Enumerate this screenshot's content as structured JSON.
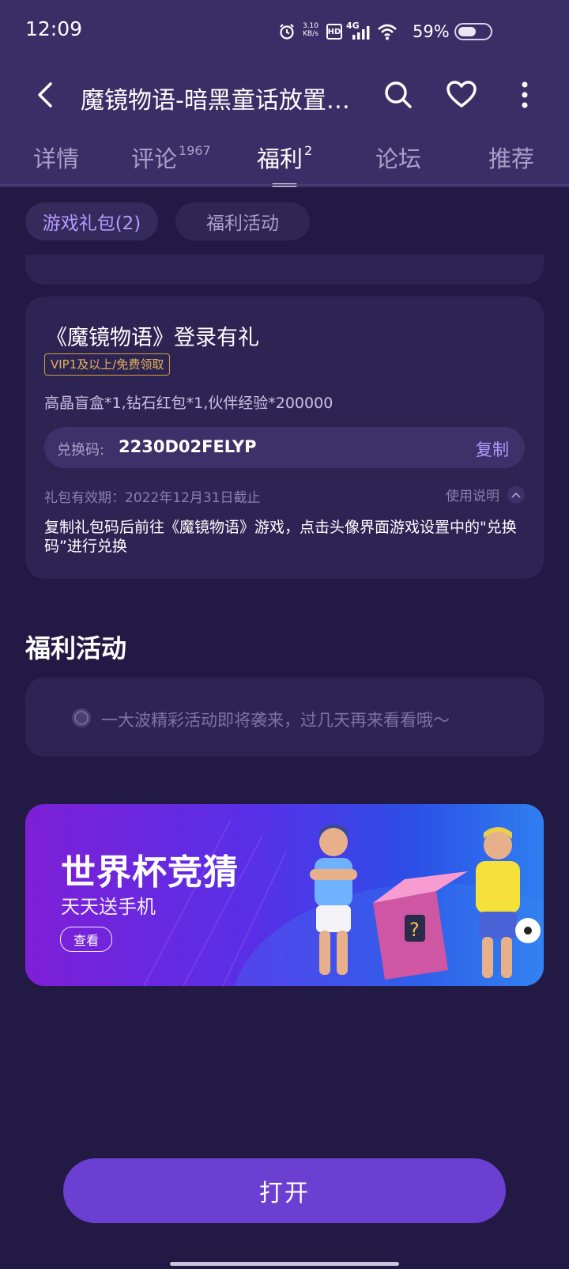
{
  "status_bar": {
    "time": "12:09",
    "speed_value": "3.10",
    "speed_unit": "KB/s",
    "hd": "HD",
    "network": "4G",
    "battery_percent": "59%",
    "battery_level": 0.59
  },
  "nav": {
    "title": "魔镜物语-暗黑童话放置RPG",
    "back_icon": "chevron-left-icon",
    "search_icon": "search-icon",
    "favorite_icon": "heart-icon",
    "more_icon": "more-vertical-icon"
  },
  "tabs": [
    {
      "label": "详情",
      "count": ""
    },
    {
      "label": "评论",
      "count": "1967"
    },
    {
      "label": "福利",
      "count": "2"
    },
    {
      "label": "论坛",
      "count": ""
    },
    {
      "label": "推荐",
      "count": ""
    }
  ],
  "chips": [
    {
      "label": "游戏礼包(2)"
    },
    {
      "label": "福利活动"
    }
  ],
  "gift": {
    "title": "《魔镜物语》登录有礼",
    "badge": "VIP1及以上/免费领取",
    "desc": "高晶盲盒*1,钻石红包*1,伙伴经验*200000",
    "code_label": "兑换码:",
    "code_value": "2230D02FELYP",
    "copy_label": "复制",
    "validity": "礼包有效期：2022年12月31日截止",
    "usage_label": "使用说明",
    "instructions": "复制礼包码后前往《魔镜物语》游戏，点击头像界面游戏设置中的\"兑换码”进行兑换"
  },
  "activities": {
    "title": "福利活动",
    "empty_text": "一大波精彩活动即将袭来，过几天再来看看哦～"
  },
  "banner": {
    "title": "世界杯竞猜",
    "subtitle": "天天送手机",
    "button": "查看"
  },
  "open_button": "打开",
  "colors": {
    "background": "#221a44",
    "header": "#3a2e66",
    "card": "#2d2454",
    "accent": "#b69aff",
    "primary_button": "#6a3fd1",
    "vip_badge": "#d2a03b"
  }
}
